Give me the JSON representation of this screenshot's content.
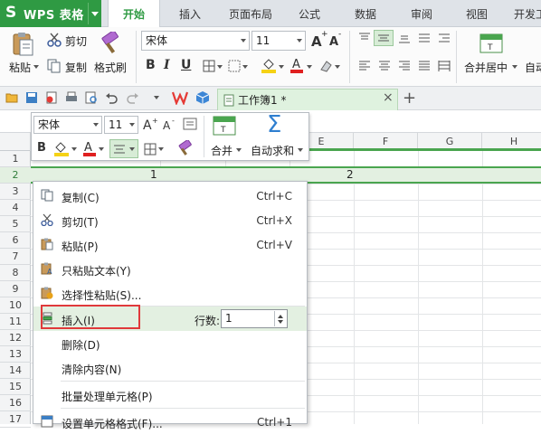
{
  "app": {
    "logo_mark": "S",
    "logo_text": "WPS 表格",
    "tabs": [
      "开始",
      "插入",
      "页面布局",
      "公式",
      "数据",
      "审阅",
      "视图",
      "开发工"
    ],
    "active_tab": "开始"
  },
  "ribbon": {
    "paste": "粘贴",
    "cut": "剪切",
    "copy": "复制",
    "format_painter": "格式刷",
    "font_name": "宋体",
    "font_size": "11",
    "grow_font": "A",
    "shrink_font": "A",
    "bold": "B",
    "italic": "I",
    "underline": "U",
    "merge_center": "合并居中",
    "auto_wrap": "自动"
  },
  "document": {
    "tab_title": "工作簿1 *",
    "new_tab": "+",
    "close": "×"
  },
  "mini_toolbar": {
    "font_name": "宋体",
    "font_size": "11",
    "bold": "B",
    "merge": "合并",
    "autosum": "自动求和",
    "sigma": "Σ"
  },
  "grid": {
    "columns": [
      "E",
      "F",
      "G",
      "H"
    ],
    "rows": [
      "1",
      "2",
      "3",
      "4",
      "5",
      "6",
      "7",
      "8",
      "9",
      "10",
      "11",
      "12",
      "13",
      "14",
      "15",
      "16",
      "17"
    ],
    "selected_row": "2",
    "cell_values": {
      "row2_a": "1",
      "row2_d": "2"
    }
  },
  "context_menu": {
    "items": [
      {
        "label": "复制(C)",
        "shortcut": "Ctrl+C",
        "icon": "copy-icon"
      },
      {
        "label": "剪切(T)",
        "shortcut": "Ctrl+X",
        "icon": "scissors-icon"
      },
      {
        "label": "粘贴(P)",
        "shortcut": "Ctrl+V",
        "icon": "paste-icon"
      },
      {
        "label": "只粘贴文本(Y)",
        "shortcut": "",
        "icon": "paste-text-icon"
      },
      {
        "label": "选择性粘贴(S)...",
        "shortcut": "",
        "icon": "paste-special-icon"
      },
      {
        "label": "插入(I)",
        "shortcut": "",
        "icon": "insert-row-icon"
      },
      {
        "label": "删除(D)",
        "shortcut": "",
        "icon": ""
      },
      {
        "label": "清除内容(N)",
        "shortcut": "",
        "icon": ""
      },
      {
        "label": "批量处理单元格(P)",
        "shortcut": "",
        "icon": ""
      },
      {
        "label": "设置单元格格式(F)...",
        "shortcut": "Ctrl+1",
        "icon": "format-cells-icon"
      }
    ],
    "insert_rows_label": "行数:",
    "insert_rows_value": "1"
  },
  "colors": {
    "brand_green": "#2f9a43",
    "selection_fill": "#e3f0e1",
    "highlight_red": "#e0393b"
  }
}
